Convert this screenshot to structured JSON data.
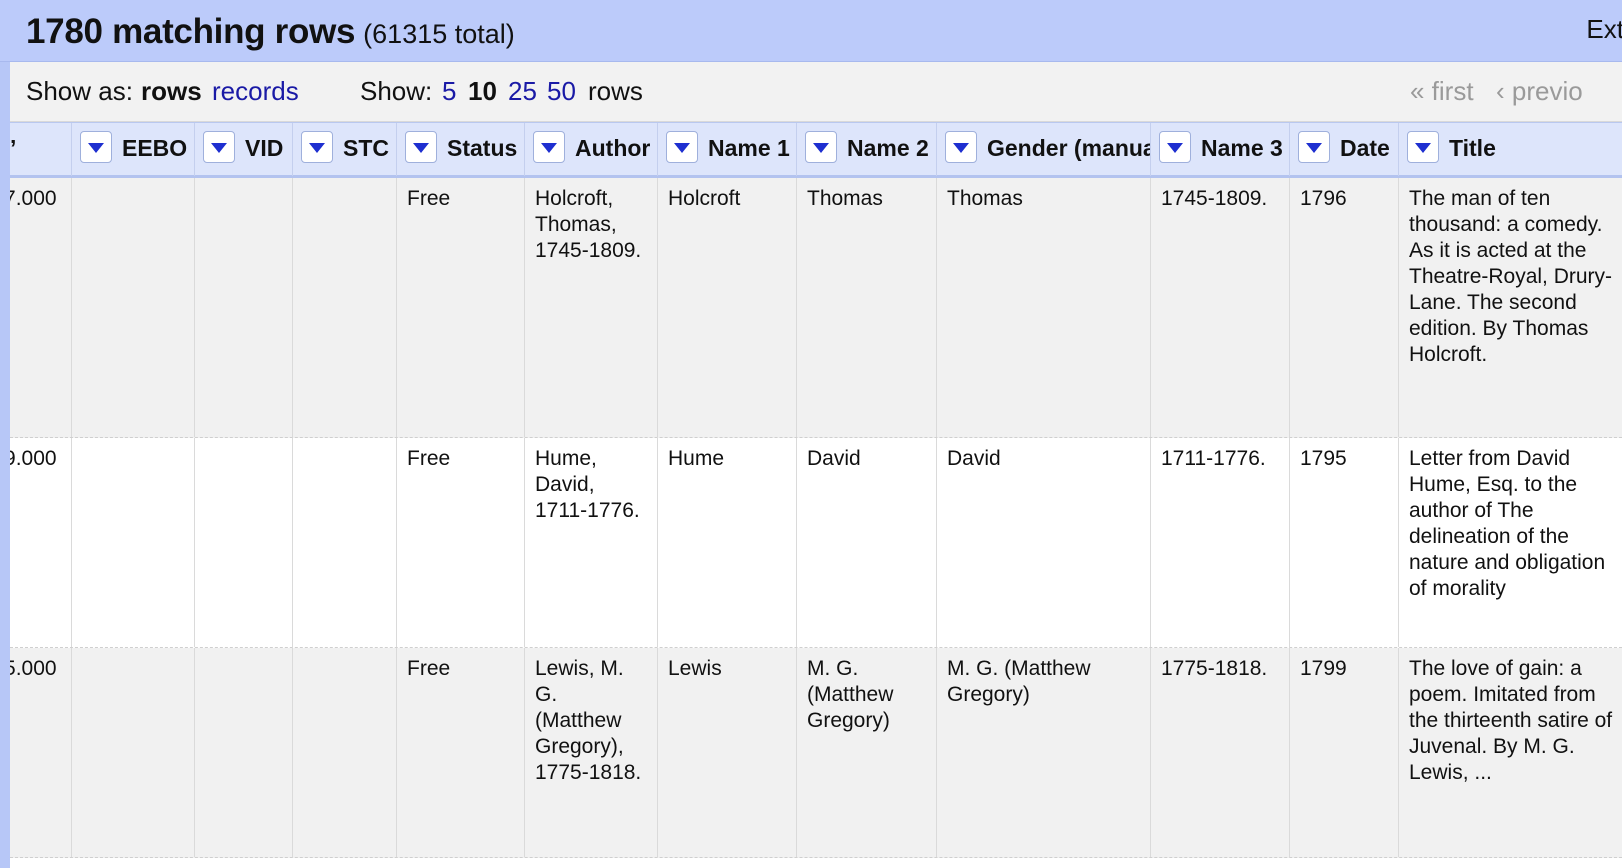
{
  "header": {
    "count_main": "1780 matching rows",
    "count_total": "(61315 total)",
    "ext_label": "Ext"
  },
  "controls": {
    "show_as_label": "Show as:",
    "rows_label": "rows",
    "records_label": "records",
    "show_label": "Show:",
    "page_sizes": [
      "5",
      "10",
      "25",
      "50"
    ],
    "page_sizes_selected": "10",
    "rows_suffix": "rows",
    "first_label": "« first",
    "previous_label": "‹ previo"
  },
  "columns": [
    "’",
    "EEBO",
    "VID",
    "STC",
    "Status",
    "Author",
    "Name 1",
    "Name 2",
    "Gender (manual)",
    "Name 3",
    "Date",
    "Title"
  ],
  "rows": [
    [
      ".000",
      "",
      "",
      "",
      "Free",
      "Holcroft, Thomas, 1745-1809.",
      "Holcroft",
      "Thomas",
      "Thomas",
      "1745-1809.",
      "1796",
      "The man of ten thousand: a comedy. As it is acted at the Theatre-Royal, Drury-Lane. The second edition. By Thomas Holcroft."
    ],
    [
      ".000",
      "",
      "",
      "",
      "Free",
      "Hume, David, 1711-1776.",
      "Hume",
      "David",
      "David",
      "1711-1776.",
      "1795",
      "Letter from David Hume, Esq. to the author of The delineation of the nature and obligation of morality"
    ],
    [
      ".000",
      "",
      "",
      "",
      "Free",
      "Lewis, M. G. (Matthew Gregory), 1775-1818.",
      "Lewis",
      "M. G. (Matthew Gregory)",
      "M. G. (Matthew Gregory)",
      "1775-1818.",
      "1799",
      "The love of gain: a poem. Imitated from the thirteenth satire of Juvenal. By M. G. Lewis, ..."
    ]
  ],
  "first_col_prefixes": [
    "7",
    "9",
    "5"
  ]
}
